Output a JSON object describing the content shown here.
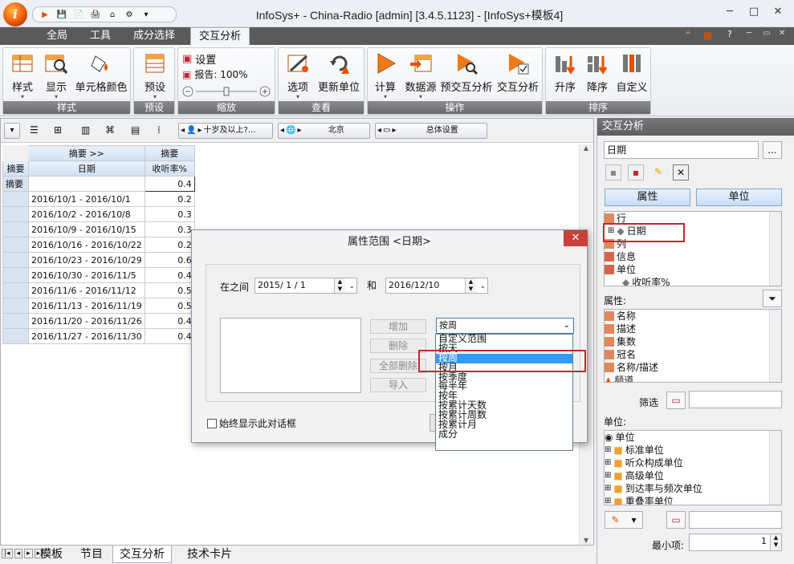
{
  "app": {
    "title": "InfoSys+ - China-Radio  [admin]  [3.4.5.1123] - [InfoSys+模板4]",
    "logo_text": "i",
    "colors": {
      "accent": "#e65100",
      "selection": "#3399ff",
      "highlight_box": "#c0282e"
    }
  },
  "window_controls": {
    "minimize": "─",
    "maximize": "□",
    "close": "✕"
  },
  "menu_tabs": [
    {
      "label": "全局"
    },
    {
      "label": "工具"
    },
    {
      "label": "成分选择"
    },
    {
      "label": "交互分析"
    }
  ],
  "ribbon": {
    "style_group": {
      "caption": "样式",
      "buttons": [
        "样式",
        "显示",
        "单元格颜色"
      ]
    },
    "preset_group": {
      "caption": "预设",
      "buttons": [
        "预设"
      ]
    },
    "zoom_group": {
      "caption": "缩放",
      "settings": "设置",
      "report": "报告: 100%"
    },
    "view_group": {
      "caption": "查看",
      "buttons": [
        "选项",
        "更新单位"
      ]
    },
    "ops_group": {
      "caption": "操作",
      "buttons": [
        "计算",
        "数据源",
        "预交互分析",
        "交互分析"
      ]
    },
    "sort_group": {
      "caption": "排序",
      "buttons": [
        "升序",
        "降序",
        "自定义"
      ]
    }
  },
  "toolbar2": {
    "age_filter": "十岁及以上?...",
    "region": "北京",
    "population": "总体设置"
  },
  "grid": {
    "header_row1": [
      "摘要 >>",
      "摘要"
    ],
    "header_row2": [
      "摘要",
      "日期",
      "收听率%"
    ],
    "summary_row": {
      "label": "摘要",
      "value": "0.4"
    },
    "rows": [
      {
        "date": "2016/10/1 - 2016/10/1",
        "value": "0.2"
      },
      {
        "date": "2016/10/2 - 2016/10/8",
        "value": "0.3"
      },
      {
        "date": "2016/10/9 - 2016/10/15",
        "value": "0.3"
      },
      {
        "date": "2016/10/16 - 2016/10/22",
        "value": "0.2"
      },
      {
        "date": "2016/10/23 - 2016/10/29",
        "value": "0.6"
      },
      {
        "date": "2016/10/30 - 2016/11/5",
        "value": "0.4"
      },
      {
        "date": "2016/11/6 - 2016/11/12",
        "value": "0.5"
      },
      {
        "date": "2016/11/13 - 2016/11/19",
        "value": "0.5"
      },
      {
        "date": "2016/11/20 - 2016/11/26",
        "value": "0.4"
      },
      {
        "date": "2016/11/27 - 2016/11/30",
        "value": "0.4"
      }
    ]
  },
  "dialog": {
    "title": "属性范围 <日期>",
    "between_label": "在之间",
    "start_date": "2015/ 1 / 1",
    "and_label": "和",
    "end_date": "2016/12/10",
    "buttons": {
      "add": "增加",
      "delete": "删除",
      "delete_all": "全部删除",
      "import": "导入"
    },
    "period_select": "按周",
    "period_options": [
      "自定义范围",
      "按天",
      "按周",
      "按月",
      "按季度",
      "每半年",
      "按年",
      "按累计天数",
      "按累计周数",
      "按累计月",
      "成分"
    ],
    "period_selected_index": 2,
    "always_show": "始终显示此对话框"
  },
  "right_pane": {
    "title": "交互分析",
    "field": "日期",
    "ellipsis": "...",
    "tab_attr": "属性",
    "tab_unit": "单位",
    "tree": [
      "行",
      "日期",
      "列",
      "信息",
      "单位",
      "收听率%"
    ],
    "attr_label": "属性:",
    "attributes": [
      "名称",
      "描述",
      "集数",
      "冠名",
      "名称/描述",
      "频道"
    ],
    "filter_label": "筛选",
    "unit_label": "单位:",
    "units": [
      "单位",
      "标准单位",
      "听众构成单位",
      "高级单位",
      "到达率与频次单位",
      "重叠率单位"
    ],
    "min_label": "最小项:",
    "min_value": "1"
  },
  "bottom_tabs": [
    "模板",
    "节目",
    "交互分析",
    "技术卡片"
  ]
}
